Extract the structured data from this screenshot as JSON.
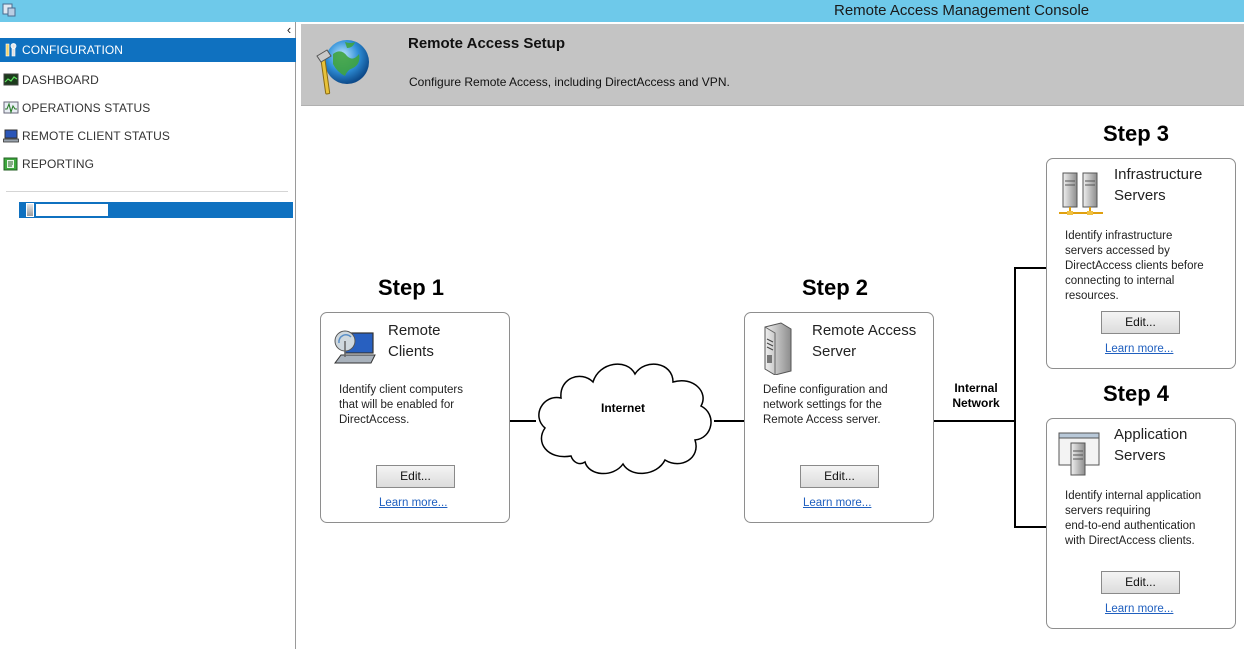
{
  "window": {
    "title": "Remote Access Management Console"
  },
  "sidebar": {
    "collapse_glyph": "‹",
    "items": [
      {
        "label": "CONFIGURATION",
        "icon": "configuration-icon",
        "active": true
      },
      {
        "label": "DASHBOARD",
        "icon": "dashboard-icon"
      },
      {
        "label": "OPERATIONS STATUS",
        "icon": "operations-status-icon"
      },
      {
        "label": "REMOTE CLIENT STATUS",
        "icon": "remote-client-status-icon"
      },
      {
        "label": "REPORTING",
        "icon": "reporting-icon"
      }
    ],
    "server_item": {
      "icon": "server-icon"
    }
  },
  "banner": {
    "title": "Remote Access Setup",
    "description": "Configure Remote Access, including DirectAccess and VPN.",
    "icon": "globe-tools-icon"
  },
  "steps": {
    "step1": {
      "label": "Step 1",
      "title": "Remote\nClients",
      "description": "Identify client computers\nthat will be enabled for\nDirectAccess.",
      "edit": "Edit...",
      "learn": "Learn more...",
      "icon": "remote-client-laptop-icon"
    },
    "step2": {
      "label": "Step 2",
      "title": "Remote Access\nServer",
      "description": "Define configuration and\nnetwork settings for the\nRemote Access server.",
      "edit": "Edit...",
      "learn": "Learn more...",
      "icon": "server-tower-icon"
    },
    "step3": {
      "label": "Step 3",
      "title": "Infrastructure\nServers",
      "description": "Identify infrastructure\nservers accessed by\nDirectAccess clients before\nconnecting to internal\nresources.",
      "edit": "Edit...",
      "learn": "Learn more...",
      "icon": "infrastructure-servers-icon"
    },
    "step4": {
      "label": "Step 4",
      "title": "Application\nServers",
      "description": "Identify internal application\nservers requiring\nend-to-end authentication\nwith DirectAccess clients.",
      "edit": "Edit...",
      "learn": "Learn more...",
      "icon": "application-server-icon"
    }
  },
  "network": {
    "internet_label": "Internet",
    "internal_label": "Internal\nNetwork"
  },
  "colors": {
    "titlebar": "#6ec9ea",
    "selection": "#0f71c0",
    "banner": "#c4c4c4",
    "link": "#1f5fbf"
  }
}
